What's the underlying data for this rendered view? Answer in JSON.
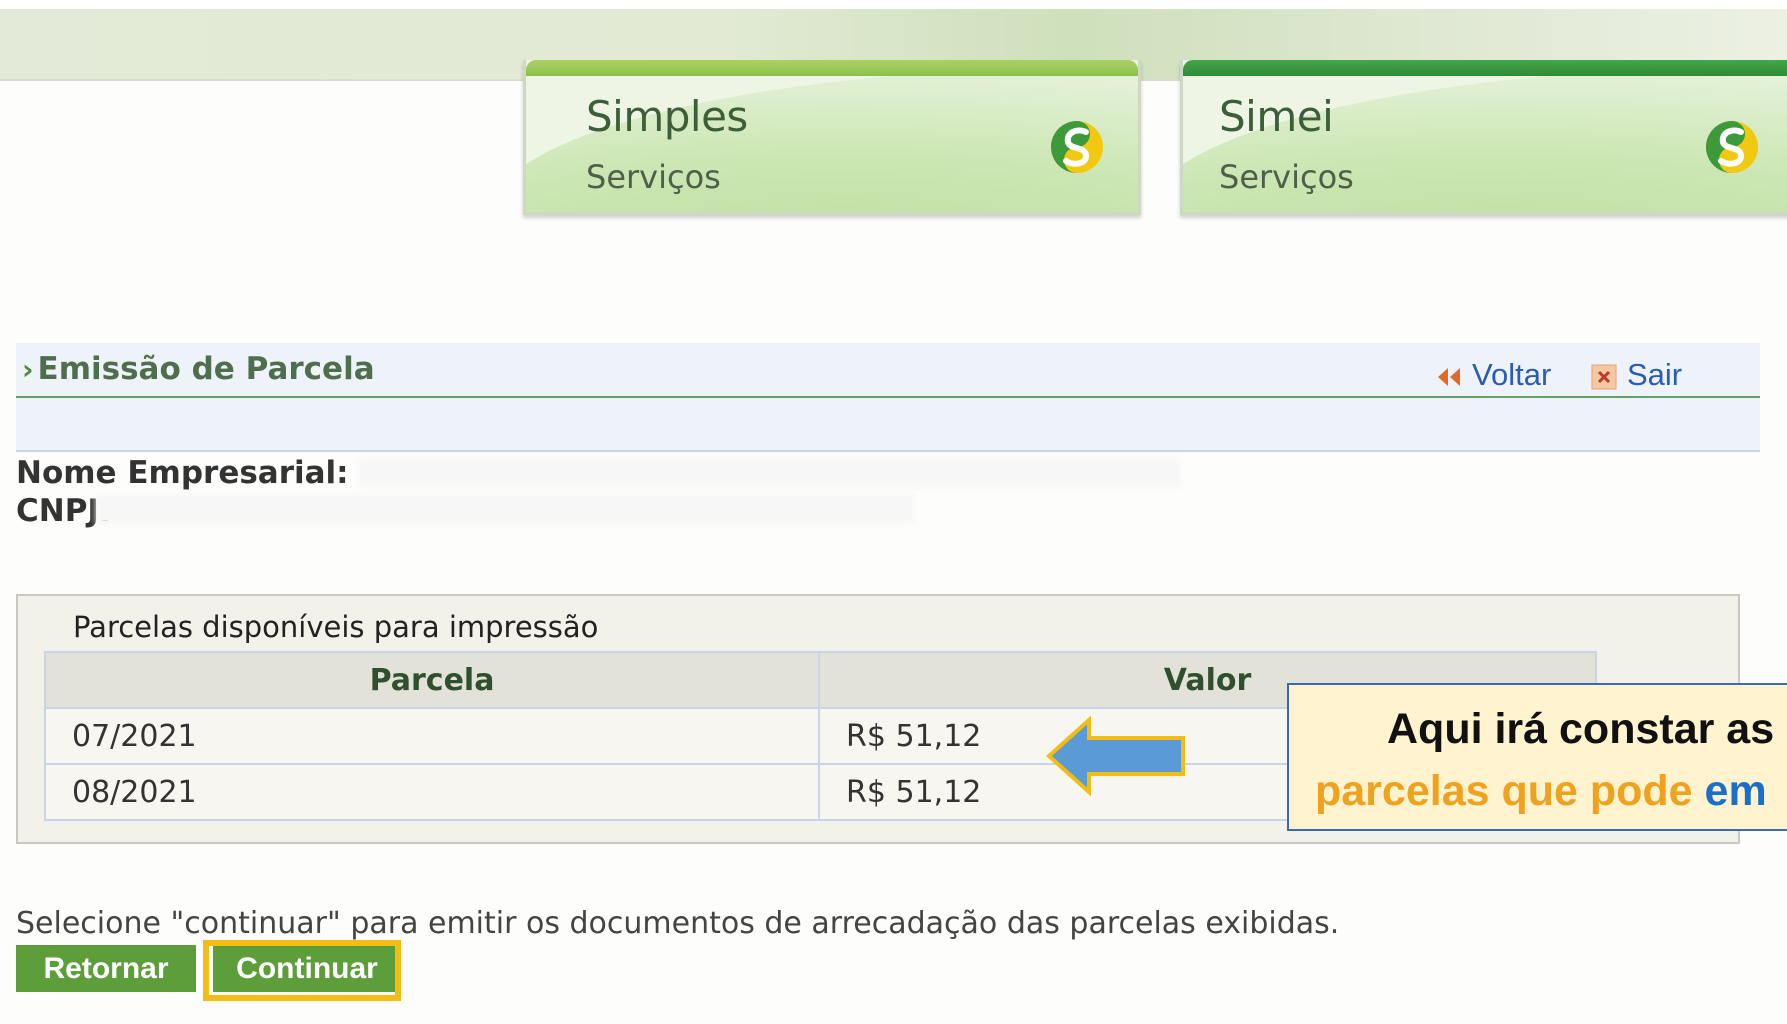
{
  "tabs": [
    {
      "title": "Simples",
      "subtitle": "Serviços"
    },
    {
      "title": "Simei",
      "subtitle": "Serviços"
    }
  ],
  "section": {
    "title": "Emissão de Parcela",
    "back_label": "Voltar",
    "exit_label": "Sair"
  },
  "company": {
    "name_label": "Nome Empresarial:",
    "cnpj_label": "CNPJ:"
  },
  "table": {
    "caption": "Parcelas disponíveis para impressão",
    "headers": [
      "Parcela",
      "Valor"
    ],
    "rows": [
      {
        "parcela": "07/2021",
        "valor": "R$ 51,12"
      },
      {
        "parcela": "08/2021",
        "valor": "R$ 51,12"
      }
    ]
  },
  "annotation": {
    "line1": "Aqui irá constar as",
    "line2_orange": "parcelas que pode ",
    "line2_blue": "em"
  },
  "footer": {
    "instruction": "Selecione \"continuar\" para emitir os documentos de arrecadação das parcelas exibidas.",
    "retornar_label": "Retornar",
    "continuar_label": "Continuar"
  },
  "colors": {
    "brand_green": "#5d9e3a",
    "link_blue": "#2a5bb6",
    "highlight_yellow": "#f4bd14",
    "callout_arrow": "#5b9bd5"
  }
}
